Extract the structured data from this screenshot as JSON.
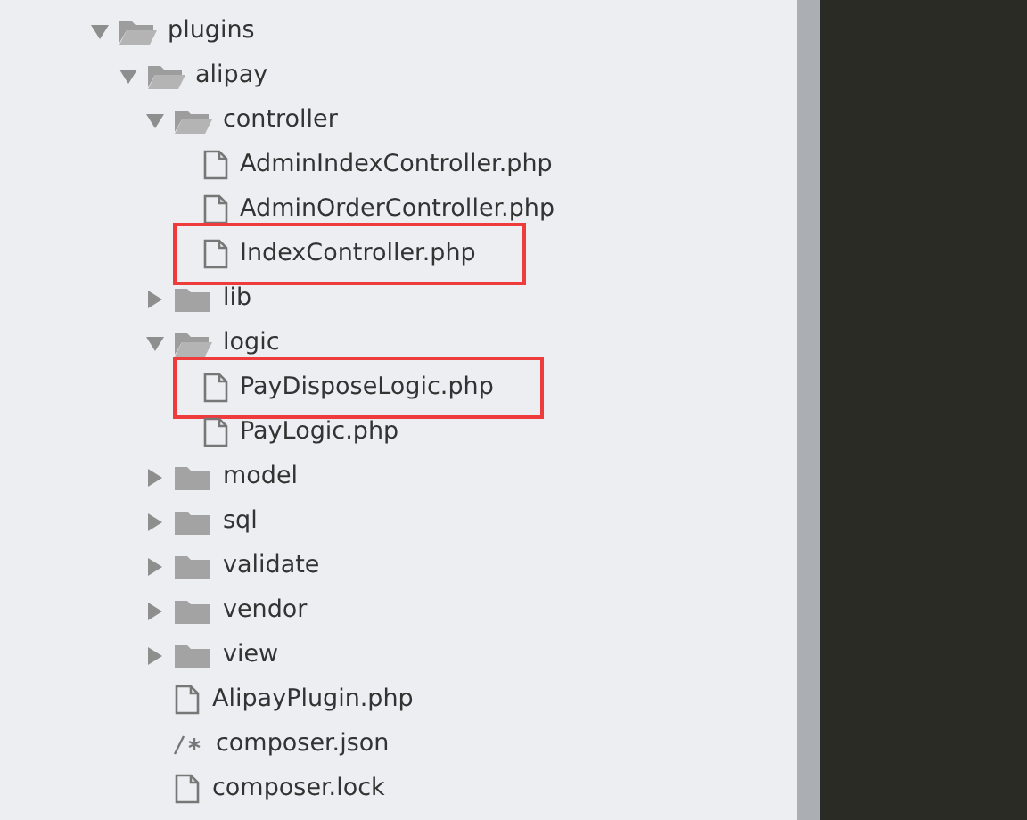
{
  "file_tree": [
    {
      "kind": "folder",
      "name": "plugins",
      "expanded": true,
      "children": [
        {
          "kind": "folder",
          "name": "alipay",
          "expanded": true,
          "children": [
            {
              "kind": "folder",
              "name": "controller",
              "expanded": true,
              "children": [
                {
                  "kind": "file",
                  "name": "AdminIndexController.php",
                  "highlighted": false
                },
                {
                  "kind": "file",
                  "name": "AdminOrderController.php",
                  "highlighted": false
                },
                {
                  "kind": "file",
                  "name": "IndexController.php",
                  "highlighted": true
                }
              ]
            },
            {
              "kind": "folder",
              "name": "lib",
              "expanded": false
            },
            {
              "kind": "folder",
              "name": "logic",
              "expanded": true,
              "children": [
                {
                  "kind": "file",
                  "name": "PayDisposeLogic.php",
                  "highlighted": true
                },
                {
                  "kind": "file",
                  "name": "PayLogic.php",
                  "highlighted": false
                }
              ]
            },
            {
              "kind": "folder",
              "name": "model",
              "expanded": false
            },
            {
              "kind": "folder",
              "name": "sql",
              "expanded": false
            },
            {
              "kind": "folder",
              "name": "validate",
              "expanded": false
            },
            {
              "kind": "folder",
              "name": "vendor",
              "expanded": false
            },
            {
              "kind": "folder",
              "name": "view",
              "expanded": false
            },
            {
              "kind": "file",
              "name": "AlipayPlugin.php",
              "highlighted": false
            },
            {
              "kind": "json",
              "name": "composer.json",
              "highlighted": false
            },
            {
              "kind": "file",
              "name": "composer.lock",
              "highlighted": false
            }
          ]
        }
      ]
    }
  ]
}
